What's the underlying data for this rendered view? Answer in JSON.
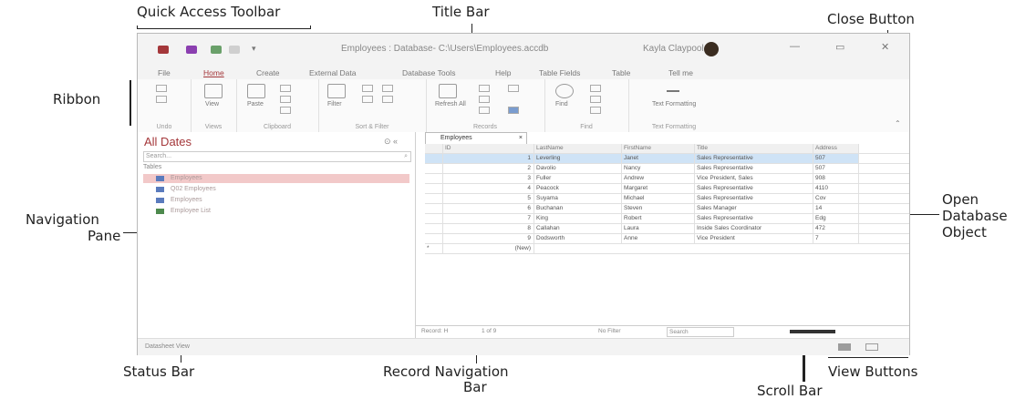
{
  "callouts": {
    "quick_access_toolbar": "Quick Access Toolbar",
    "title_bar": "Title Bar",
    "close_button": "Close Button",
    "ribbon": "Ribbon",
    "navigation_pane_1": "Navigation",
    "navigation_pane_2": "Pane",
    "open_object_1": "Open",
    "open_object_2": "Database",
    "open_object_3": "Object",
    "status_bar": "Status Bar",
    "record_nav_1": "Record Navigation",
    "record_nav_2": "Bar",
    "scroll_bar": "Scroll Bar",
    "view_buttons": "View Buttons"
  },
  "window": {
    "title": "Employees : Database- C:\\Users\\Employees.accdb",
    "user": "Kayla Claypool",
    "controls": {
      "minimize": "—",
      "restore": "▭",
      "close": "✕"
    }
  },
  "tabs": [
    "File",
    "Home",
    "Create",
    "External Data",
    "Database Tools",
    "Help",
    "Table Fields",
    "Table",
    "Tell me"
  ],
  "active_tab": "Home",
  "ribbon_groups": [
    "Undo",
    "Views",
    "Clipboard",
    "Sort & Filter",
    "Records",
    "Find",
    "Text Formatting"
  ],
  "ribbon_buttons": {
    "view": "View",
    "paste": "Paste",
    "filter": "Filter",
    "refresh": "Refresh All",
    "find": "Find",
    "text_formatting": "Text Formatting"
  },
  "nav": {
    "title": "All Dates",
    "controls": "⊙ «",
    "search_placeholder": "Search...",
    "section": "Tables",
    "items": [
      "Employees",
      "Q02 Employees",
      "Employees",
      "Employee List"
    ]
  },
  "table": {
    "tab_label": "Employees",
    "columns": [
      "ID",
      "LastName",
      "FirstName",
      "Title",
      "Address"
    ],
    "rows": [
      [
        "1",
        "Leverling",
        "Janet",
        "Sales Representative",
        "507"
      ],
      [
        "2",
        "Davolio",
        "Nancy",
        "Sales Representative",
        "507"
      ],
      [
        "3",
        "Fuller",
        "Andrew",
        "Vice President, Sales",
        "908"
      ],
      [
        "4",
        "Peacock",
        "Margaret",
        "Sales Representative",
        "4110"
      ],
      [
        "5",
        "Suyama",
        "Michael",
        "Sales Representative",
        "Cov"
      ],
      [
        "6",
        "Buchanan",
        "Steven",
        "Sales Manager",
        "14"
      ],
      [
        "7",
        "King",
        "Robert",
        "Sales Representative",
        "Edg"
      ],
      [
        "8",
        "Callahan",
        "Laura",
        "Inside Sales Coordinator",
        "472"
      ],
      [
        "9",
        "Dodsworth",
        "Anne",
        "Vice President",
        "7"
      ]
    ],
    "new_row": "(New)"
  },
  "record_nav": {
    "label": "Record: H",
    "position": "1 of 9",
    "filter": "No Filter",
    "search": "Search"
  },
  "status_bar": {
    "text": "Datasheet View"
  },
  "colors": {
    "accent": "#a4373a",
    "selected_row": "#cfe3f6",
    "nav_selected": "#f2c9c9"
  }
}
